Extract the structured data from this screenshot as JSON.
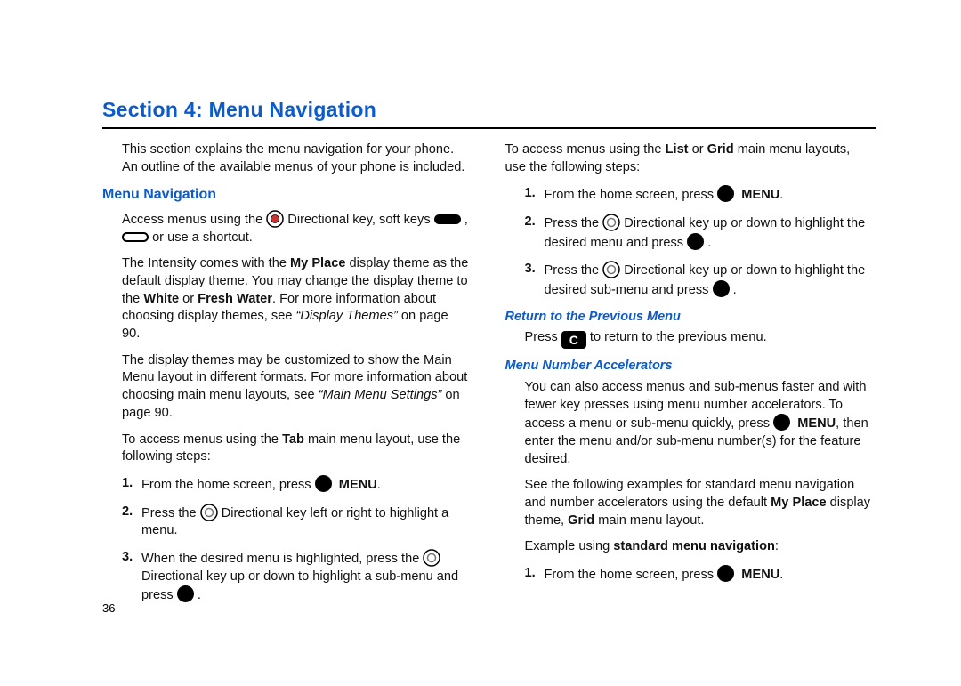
{
  "page_number": "36",
  "section_title": "Section 4:  Menu Navigation",
  "left": {
    "intro": "This section explains the menu navigation for your phone. An outline of the available menus of your phone is included.",
    "h2": "Menu Navigation",
    "p1_a": "Access menus using the ",
    "p1_b": " Directional key, soft keys ",
    "p1_c": " , ",
    "p1_d": " or use a shortcut.",
    "p2_a": "The Intensity comes with the ",
    "p2_bold1": "My Place",
    "p2_b": " display theme as the default display theme. You may change the display theme to the ",
    "p2_bold2": "White",
    "p2_c": " or ",
    "p2_bold3": "Fresh Water",
    "p2_d": ". For more information about choosing display themes, see ",
    "p2_ref": "“Display Themes”",
    "p2_e": " on page 90.",
    "p3_a": "The display themes may be customized to show the Main Menu layout in different formats. For more information about choosing main menu layouts, see ",
    "p3_ref": "“Main Menu Settings”",
    "p3_b": " on page 90.",
    "p4_a": "To access menus using the ",
    "p4_bold": "Tab",
    "p4_b": " main menu layout, use the following steps:",
    "step1_a": "From the home screen, press ",
    "step1_bold": "MENU",
    "step1_b": ".",
    "step2_a": "Press the ",
    "step2_b": " Directional key left or right to highlight a menu.",
    "step3_a": "When the desired menu is highlighted, press the ",
    "step3_b": " Directional key up or down to highlight a sub-menu and press ",
    "step3_c": " ."
  },
  "right": {
    "p1_a": "To access menus using the ",
    "p1_bold1": "List",
    "p1_b": " or ",
    "p1_bold2": "Grid",
    "p1_c": " main menu layouts, use the following steps:",
    "step1_a": "From the home screen, press ",
    "step1_bold": "MENU",
    "step1_b": ".",
    "step2_a": "Press the ",
    "step2_b": " Directional key up or down to highlight the desired menu and press ",
    "step2_c": " .",
    "step3_a": "Press the ",
    "step3_b": " Directional key up or down to highlight the desired sub-menu and press ",
    "step3_c": " .",
    "h3a": "Return to the Previous Menu",
    "return_a": "Press ",
    "return_key": "C",
    "return_b": " to return to the previous menu.",
    "h3b": "Menu Number Accelerators",
    "accel_p1_a": "You can also access menus and sub-menus faster and with fewer key presses using menu number accelerators. To access a menu or sub-menu quickly, press ",
    "accel_p1_bold": "MENU",
    "accel_p1_b": ", then enter the menu and/or sub-menu number(s) for the feature desired.",
    "accel_p2_a": "See the following examples for standard menu navigation and number accelerators using the default ",
    "accel_p2_bold1": "My Place",
    "accel_p2_b": " display theme, ",
    "accel_p2_bold2": "Grid",
    "accel_p2_c": " main menu layout.",
    "accel_ex_a": "Example using ",
    "accel_ex_bold": "standard menu navigation",
    "accel_ex_b": ":",
    "step1b_a": "From the home screen, press ",
    "step1b_bold": "MENU",
    "step1b_b": "."
  }
}
